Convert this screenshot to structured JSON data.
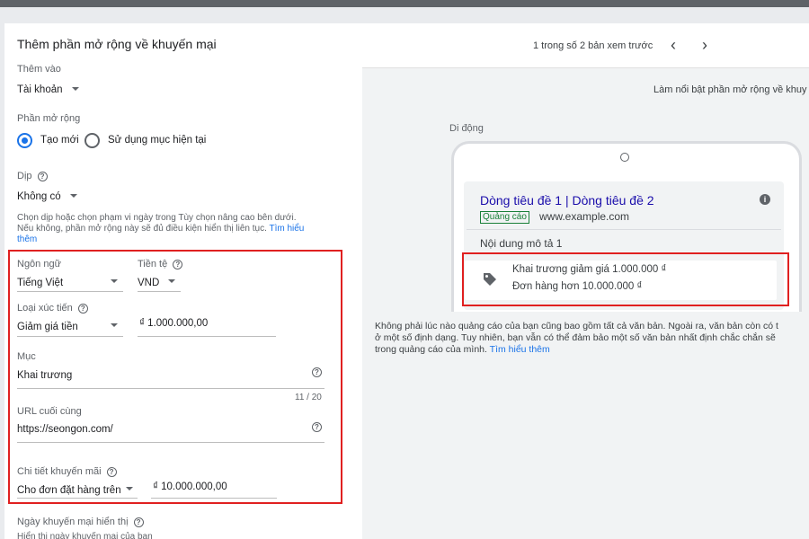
{
  "form": {
    "title": "Thêm phần mở rộng về khuyến mại",
    "add_to": {
      "label": "Thêm vào",
      "value": "Tài khoản"
    },
    "extension": {
      "label": "Phần mở rộng",
      "option_new": "Tạo mới",
      "option_existing": "Sử dụng mục hiện tại",
      "selected": "Tạo mới"
    },
    "occasion": {
      "label": "Dịp",
      "value": "Không có",
      "help_line1": "Chọn dịp hoặc chọn phạm vi ngày trong Tùy chọn nâng cao bên dưới.",
      "help_line2": "Nếu không, phần mở rộng này sẽ đủ điều kiện hiển thị liên tục.",
      "help_link": "Tìm hiểu",
      "help_link2": "thêm"
    },
    "language": {
      "label": "Ngôn ngữ",
      "value": "Tiếng Việt"
    },
    "currency": {
      "label": "Tiền tệ",
      "value": "VND"
    },
    "promo_type": {
      "label": "Loại xúc tiến",
      "value": "Giảm giá tiền",
      "amount": "₫ 1.000.000,00"
    },
    "item": {
      "label": "Mục",
      "value": "Khai trương",
      "counter": "11 / 20"
    },
    "final_url": {
      "label": "URL cuối cùng",
      "value": "https://seongon.com/"
    },
    "promo_details": {
      "label": "Chi tiết khuyến mãi",
      "value": "Cho đơn đặt hàng trên",
      "amount": "₫ 10.000.000,00"
    },
    "display_date": {
      "label": "Ngày khuyến mại hiển thị",
      "sub": "Hiển thị ngày khuyến mại của bạn"
    }
  },
  "preview": {
    "pager": "1 trong số 2 bản xem trước",
    "prev_icon": "chevron-left-icon",
    "next_icon": "chevron-right-icon",
    "highlight_text": "Làm nổi bật phần mở rộng về khuy",
    "device_label": "Di động",
    "ad": {
      "headline": "Dòng tiêu đề 1 | Dòng tiêu đề 2",
      "badge": "Quảng cáo",
      "url": "www.example.com",
      "description": "Nội dung mô tả 1",
      "promo_line1": "Khai trương giảm giá 1.000.000 ₫",
      "promo_line2": "Đơn hàng hơn 10.000.000 ₫"
    },
    "note_line1": "Không phải lúc nào quảng cáo của bạn cũng bao gồm tất cả văn bản. Ngoài ra, văn bản còn có t",
    "note_line2": "ở một số định dạng. Tuy nhiên, bạn vẫn có thể đảm bảo một số văn bản nhất định chắc chắn sẽ",
    "note_line3": "trong quảng cáo của mình.",
    "note_link": "Tìm hiểu thêm"
  },
  "colors": {
    "accent": "#1a73e8",
    "highlight": "#e02020",
    "ad_green": "#188038",
    "headline": "#1a0dab"
  }
}
